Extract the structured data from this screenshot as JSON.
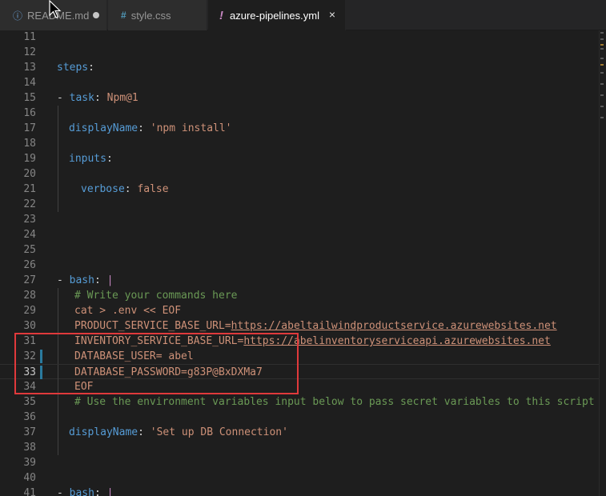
{
  "tabs": [
    {
      "label": "README.md",
      "icon": "info-icon",
      "modified": true
    },
    {
      "label": "style.css",
      "icon": "hash-icon"
    },
    {
      "label": "azure-pipelines.yml",
      "icon": "exclamation-icon",
      "active": true
    }
  ],
  "tab_icons": {
    "info": "ⓘ",
    "hash": "#",
    "yaml": "!",
    "close": "×"
  },
  "lines": [
    {
      "n": "11"
    },
    {
      "n": "12"
    },
    {
      "n": "13",
      "key": "steps",
      "colon": ":"
    },
    {
      "n": "14"
    },
    {
      "n": "15",
      "dash": "- ",
      "key": "task",
      "colon": ": ",
      "val": "Npm@1"
    },
    {
      "n": "16"
    },
    {
      "n": "17",
      "key": "displayName",
      "colon": ": ",
      "val": "'npm install'"
    },
    {
      "n": "18"
    },
    {
      "n": "19",
      "key": "inputs",
      "colon": ":"
    },
    {
      "n": "20"
    },
    {
      "n": "21",
      "key": "verbose",
      "colon": ": ",
      "val": "false"
    },
    {
      "n": "22"
    },
    {
      "n": "23"
    },
    {
      "n": "24"
    },
    {
      "n": "25"
    },
    {
      "n": "26"
    },
    {
      "n": "27",
      "dash": "- ",
      "key": "bash",
      "colon": ": ",
      "pipe": "|"
    },
    {
      "n": "28",
      "comment": "# Write your commands here"
    },
    {
      "n": "29",
      "text": "cat > .env << EOF"
    },
    {
      "n": "30",
      "prefix": "PRODUCT_SERVICE_BASE_URL=",
      "link": "https://abeltailwindproductservice.azurewebsites.net"
    },
    {
      "n": "31",
      "prefix": "INVENTORY_SERVICE_BASE_URL=",
      "link": "https://abelinventoryserviceapi.azurewebsites.net"
    },
    {
      "n": "32",
      "text": "DATABASE_USER= abel"
    },
    {
      "n": "33",
      "text": "DATABASE_PASSWORD=g83P@BxDXMa7"
    },
    {
      "n": "34",
      "text": "EOF"
    },
    {
      "n": "35",
      "comment": "# Use the environment variables input below to pass secret variables to this script"
    },
    {
      "n": "36"
    },
    {
      "n": "37",
      "key": "displayName",
      "colon": ": ",
      "val": "'Set up DB Connection'"
    },
    {
      "n": "38"
    },
    {
      "n": "39"
    },
    {
      "n": "40"
    },
    {
      "n": "41",
      "dash": "- ",
      "key": "bash",
      "colon": ": ",
      "pipe": "|"
    }
  ],
  "colors": {
    "keyword": "#569cd6",
    "string": "#ce9178",
    "comment": "#6a9955",
    "plain": "#d4d4d4",
    "highlight_box": "#e0393b",
    "gutter_modified": "#2a7a9e"
  }
}
